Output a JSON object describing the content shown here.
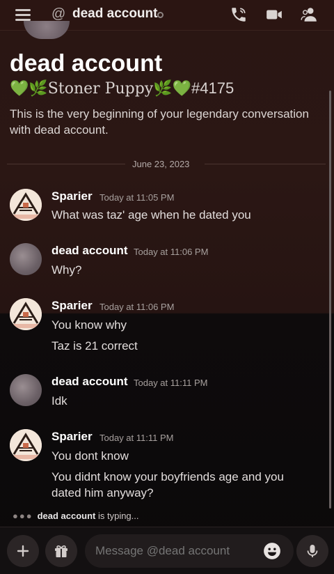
{
  "header": {
    "title": "dead account",
    "icons": [
      "menu-icon",
      "at-icon",
      "call-icon",
      "video-icon",
      "members-icon"
    ]
  },
  "profile": {
    "name": "dead account",
    "tag_text": "💚🌿Stoner Puppy🌿💚",
    "tag_number": "#4175",
    "intro": "This is the very beginning of your legendary conversation with dead account."
  },
  "divider_date": "June 23, 2023",
  "messages": [
    {
      "author": "Sparier",
      "time": "Today at 11:05 PM",
      "lines": [
        "What was taz' age when he dated you"
      ]
    },
    {
      "author": "dead account",
      "time": "Today at 11:06 PM",
      "lines": [
        "Why?"
      ]
    },
    {
      "author": "Sparier",
      "time": "Today at 11:06 PM",
      "lines": [
        "You know why",
        "Taz is 21 correct"
      ]
    },
    {
      "author": "dead account",
      "time": "Today at 11:11 PM",
      "lines": [
        "Idk"
      ]
    },
    {
      "author": "Sparier",
      "time": "Today at 11:11 PM",
      "lines": [
        "You dont know",
        "You didnt know your boyfriends age and you dated him anyway?"
      ]
    }
  ],
  "typing": {
    "user": "dead account",
    "suffix": " is typing..."
  },
  "composer": {
    "placeholder": "Message @dead account"
  },
  "colors": {
    "background_top": "#2a1613",
    "background_bottom": "#0b090a",
    "text": "#e8e6e6"
  }
}
